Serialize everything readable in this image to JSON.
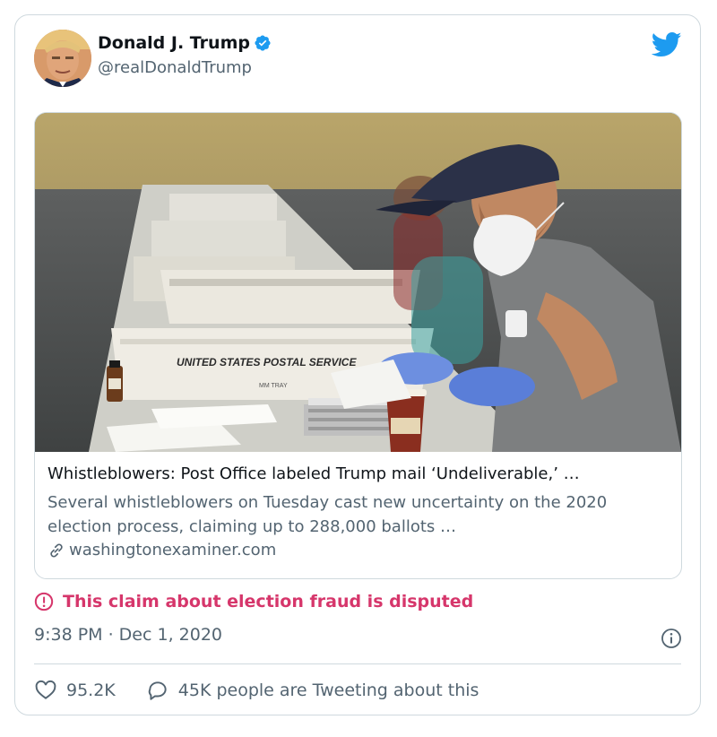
{
  "author": {
    "name": "Donald J. Trump",
    "handle": "@realDonaldTrump"
  },
  "card": {
    "title": "Whistleblowers: Post Office labeled Trump mail ‘Undeliverable,’ …",
    "description": "Several whistleblowers on Tuesday cast new uncertainty on the 2020 election process, claiming up to 288,000 ballots …",
    "domain": "washingtonexaminer.com",
    "photo_text": {
      "bin_label": "UNITED STATES POSTAL SERVICE",
      "tray_label": "MM TRAY"
    }
  },
  "dispute": {
    "text": "This claim about election fraud is disputed"
  },
  "timestamp": "9:38 PM · Dec 1, 2020",
  "stats": {
    "likes": "95.2K",
    "tweeting": "45K people are Tweeting about this"
  },
  "colors": {
    "accent": "#1d9bf0",
    "dispute": "#d6366b",
    "secondary_text": "#536471",
    "border": "#cfd9de"
  }
}
